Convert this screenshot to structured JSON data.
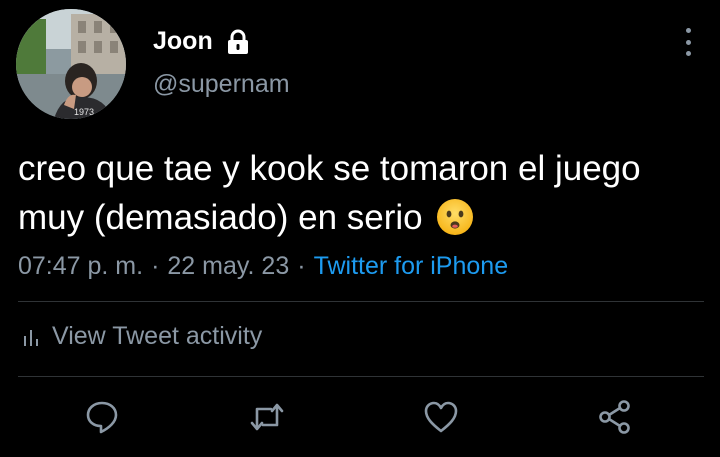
{
  "author": {
    "name": "Joon",
    "handle": "@supernam",
    "protected_icon": "lock-icon",
    "avatar_caption": "1973"
  },
  "tweet": {
    "text": "creo que tae y kook se tomaron el juego muy (demasiado) en serio",
    "emoji_icon": "frowning-face-icon",
    "time": "07:47 p. m.",
    "date": "22 may. 23",
    "separator": "·",
    "source": "Twitter for iPhone"
  },
  "activity": {
    "label": "View Tweet activity",
    "icon": "bar-chart-icon"
  },
  "actions": [
    "reply-icon",
    "retweet-icon",
    "like-icon",
    "share-icon"
  ],
  "colors": {
    "background": "#000000",
    "text": "#ffffff",
    "secondary": "#8b98a5",
    "accent": "#1d9bf0",
    "divider": "#2f3336"
  }
}
